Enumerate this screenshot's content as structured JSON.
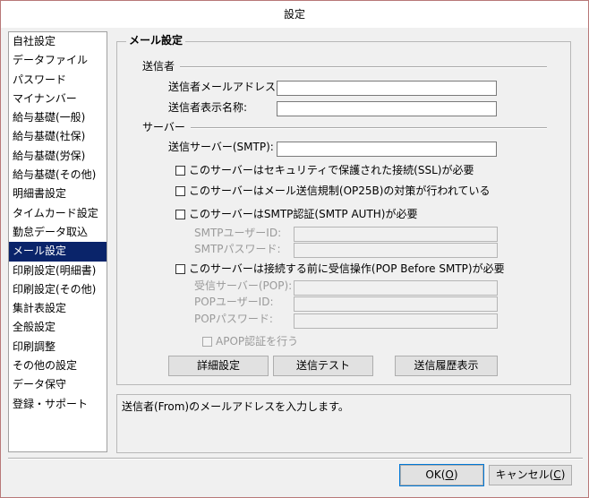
{
  "window": {
    "title": "設定"
  },
  "sidebar": {
    "items": [
      {
        "label": "自社設定"
      },
      {
        "label": "データファイル"
      },
      {
        "label": "パスワード"
      },
      {
        "label": "マイナンバー"
      },
      {
        "label": "給与基礎(一般)"
      },
      {
        "label": "給与基礎(社保)"
      },
      {
        "label": "給与基礎(労保)"
      },
      {
        "label": "給与基礎(その他)"
      },
      {
        "label": "明細書設定"
      },
      {
        "label": "タイムカード設定"
      },
      {
        "label": "勤怠データ取込"
      },
      {
        "label": "メール設定"
      },
      {
        "label": "印刷設定(明細書)"
      },
      {
        "label": "印刷設定(その他)"
      },
      {
        "label": "集計表設定"
      },
      {
        "label": "全般設定"
      },
      {
        "label": "印刷調整"
      },
      {
        "label": "その他の設定"
      },
      {
        "label": "データ保守"
      },
      {
        "label": "登録・サポート"
      }
    ],
    "selected_index": 11
  },
  "panel": {
    "title": "メール設定",
    "sender": {
      "section": "送信者",
      "address_label": "送信者メールアドレス:",
      "address_value": "",
      "name_label": "送信者表示名称:",
      "name_value": ""
    },
    "server": {
      "section": "サーバー",
      "smtp_label": "送信サーバー(SMTP):",
      "smtp_value": "",
      "ssl_label": "このサーバーはセキュリティで保護された接続(SSL)が必要",
      "op25b_label": "このサーバーはメール送信規制(OP25B)の対策が行われている",
      "smtp_auth_label": "このサーバーはSMTP認証(SMTP AUTH)が必要",
      "smtp_user_label": "SMTPユーザーID:",
      "smtp_pass_label": "SMTPパスワード:",
      "pop_before_label": "このサーバーは接続する前に受信操作(POP Before SMTP)が必要",
      "pop_server_label": "受信サーバー(POP):",
      "pop_user_label": "POPユーザーID:",
      "pop_pass_label": "POPパスワード:",
      "apop_label": "APOP認証を行う"
    },
    "buttons": {
      "detail": "詳細設定",
      "test": "送信テスト",
      "history": "送信履歴表示"
    }
  },
  "help_text": "送信者(From)のメールアドレスを入力します。",
  "footer": {
    "ok_text": "OK(",
    "ok_key": "O",
    "ok_close": ")",
    "cancel_text": "キャンセル(",
    "cancel_key": "C",
    "cancel_close": ")"
  }
}
